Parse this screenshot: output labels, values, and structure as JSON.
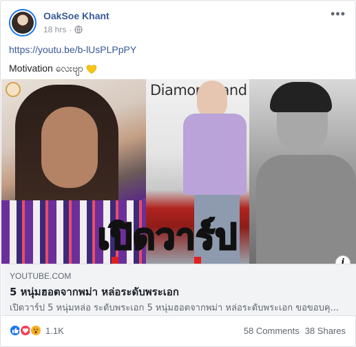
{
  "post": {
    "author": "OakSoe Khant",
    "time": "18 hrs",
    "dot": "·",
    "privacy_icon": "globe-icon",
    "more_icon": "more-options-icon",
    "more_label": "•••",
    "link": "https://youtu.be/b-lUsPLPpPY",
    "status_text": "Motivation လေးဗျာ",
    "status_emoji": "yellow-heart-icon"
  },
  "preview": {
    "image_label_text": "DiamondLand",
    "overlay_text": "เปิดวาร์ป",
    "info_icon": "info-icon",
    "info_label": "i"
  },
  "link_box": {
    "domain": "YOUTUBE.COM",
    "title": "5 หนุ่มฮอตจากพม่า หล่อระดับพระเอก",
    "description": "เปิดวาร์ป 5 หนุ่มหล่อ ระดับพระเอก 5 หนุ่มฮอตจากพม่า หล่อระดับพระเอก ขอขอบคุ..."
  },
  "footer": {
    "reaction_icons": [
      "like-icon",
      "love-icon",
      "wow-icon"
    ],
    "reactions_count": "1.1K",
    "comments": "58 Comments",
    "shares": "38 Shares"
  },
  "colors": {
    "author_link": "#385898",
    "like_blue": "#1877f2",
    "love_red": "#f33e58",
    "wow_yellow": "#f7b125",
    "secondary_text": "#606770"
  }
}
